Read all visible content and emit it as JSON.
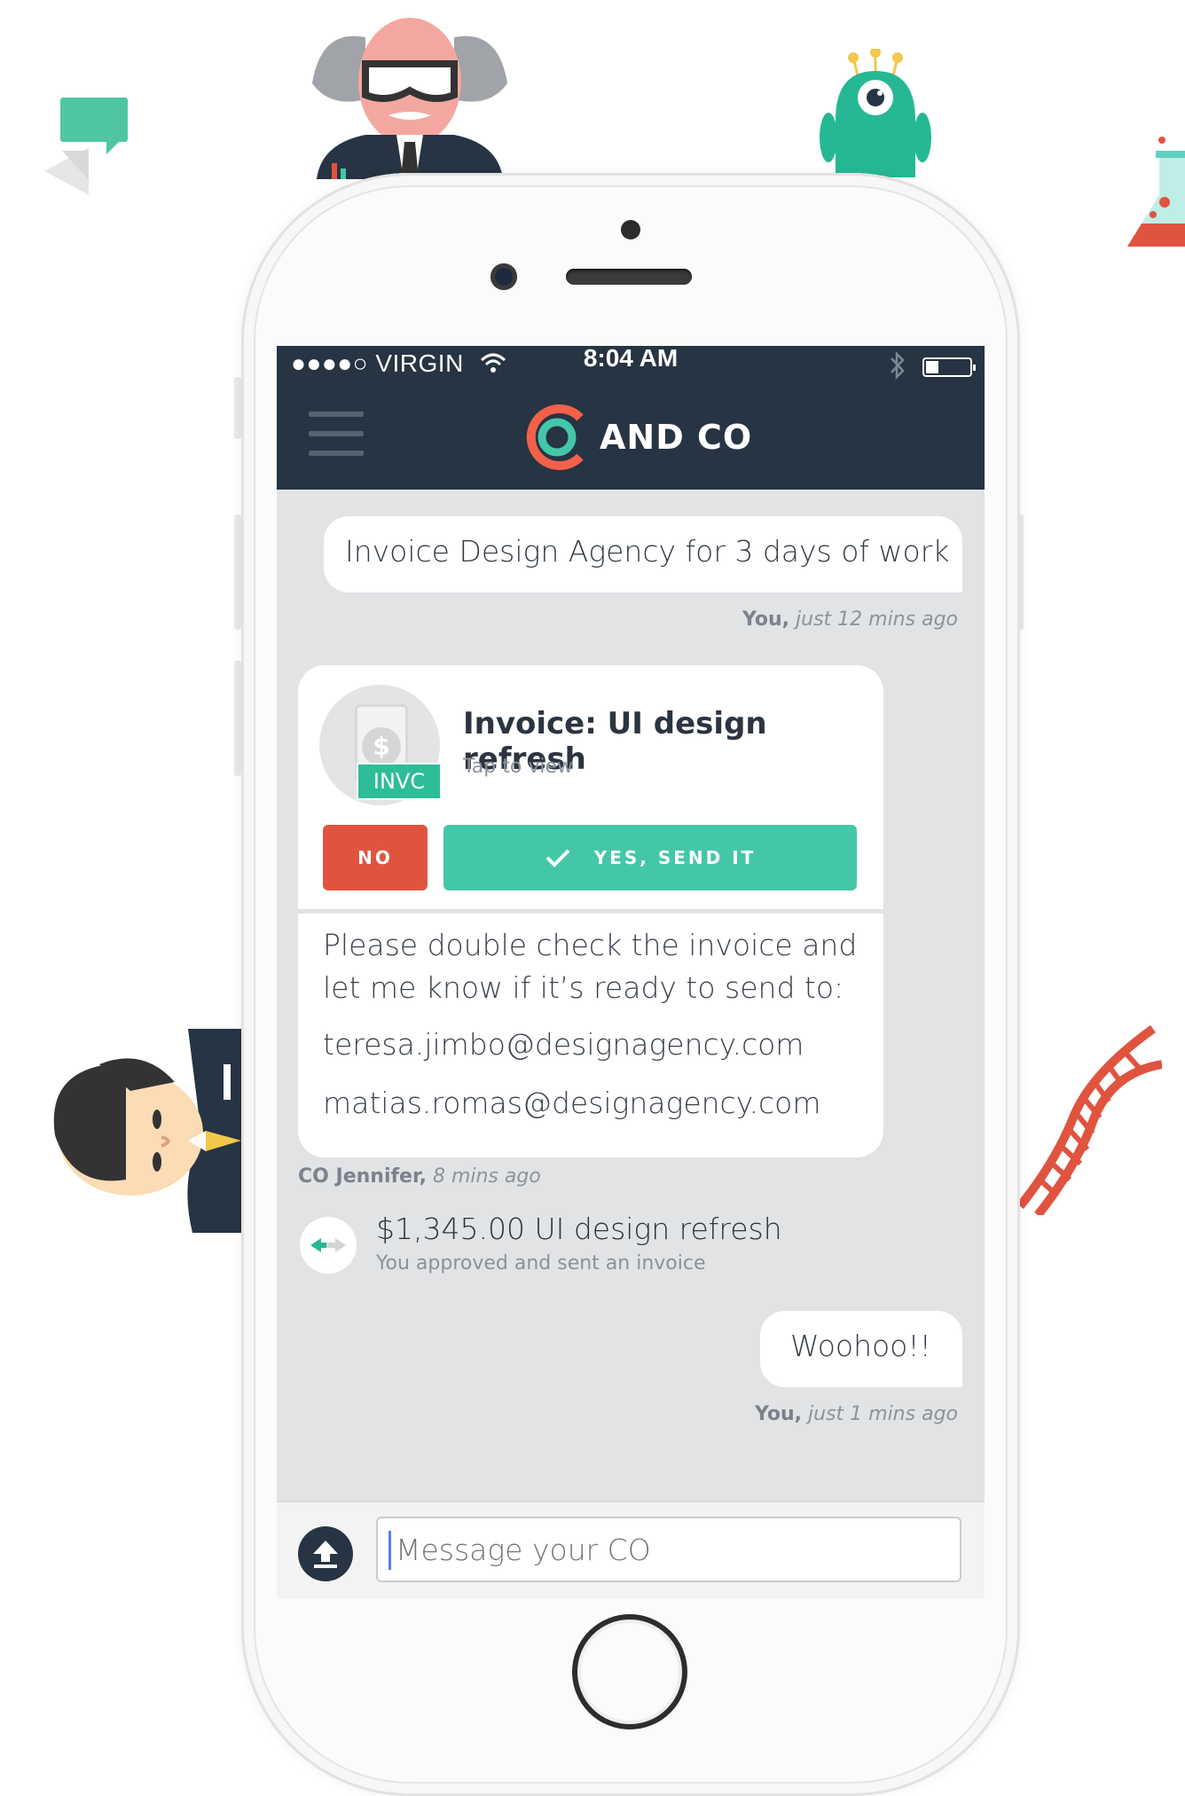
{
  "status_bar": {
    "carrier": "●●●●○ VIRGIN",
    "time": "8:04 AM",
    "battery_level": 0.3
  },
  "header": {
    "brand": "AND CO"
  },
  "messages": {
    "user_request": {
      "text": "Invoice Design Agency for 3 days of work",
      "author": "You,",
      "time": "just 12 mins ago"
    },
    "invoice_card": {
      "badge": "INVC",
      "currency_symbol": "$",
      "title": "Invoice: UI design refresh",
      "subtitle": "Tap to view",
      "no_label": "NO",
      "yes_label": "YES, SEND IT"
    },
    "co_message": {
      "line1": "Please double check the invoice and",
      "line2": "let me know if it’s ready to send to:",
      "email1": "teresa.jimbo@designagency.com",
      "email2": "matias.romas@designagency.com",
      "author": "CO Jennifer,",
      "time": "8 mins ago"
    },
    "activity": {
      "title": "$1,345.00 UI design refresh",
      "subtitle": "You approved and sent an invoice"
    },
    "user_reply": {
      "text": "Woohoo!!",
      "author": "You,",
      "time": "just 1 mins ago"
    }
  },
  "composer": {
    "placeholder": "Message your CO"
  },
  "colors": {
    "navbar": "#263443",
    "accent_green": "#44c7a8",
    "danger_red": "#e0533f",
    "logo_orange": "#f2604a"
  },
  "icons": [
    "hamburger-icon",
    "wifi-icon",
    "bluetooth-icon",
    "battery-icon",
    "invoice-icon",
    "check-icon",
    "transfer-arrows-icon",
    "upload-icon"
  ]
}
